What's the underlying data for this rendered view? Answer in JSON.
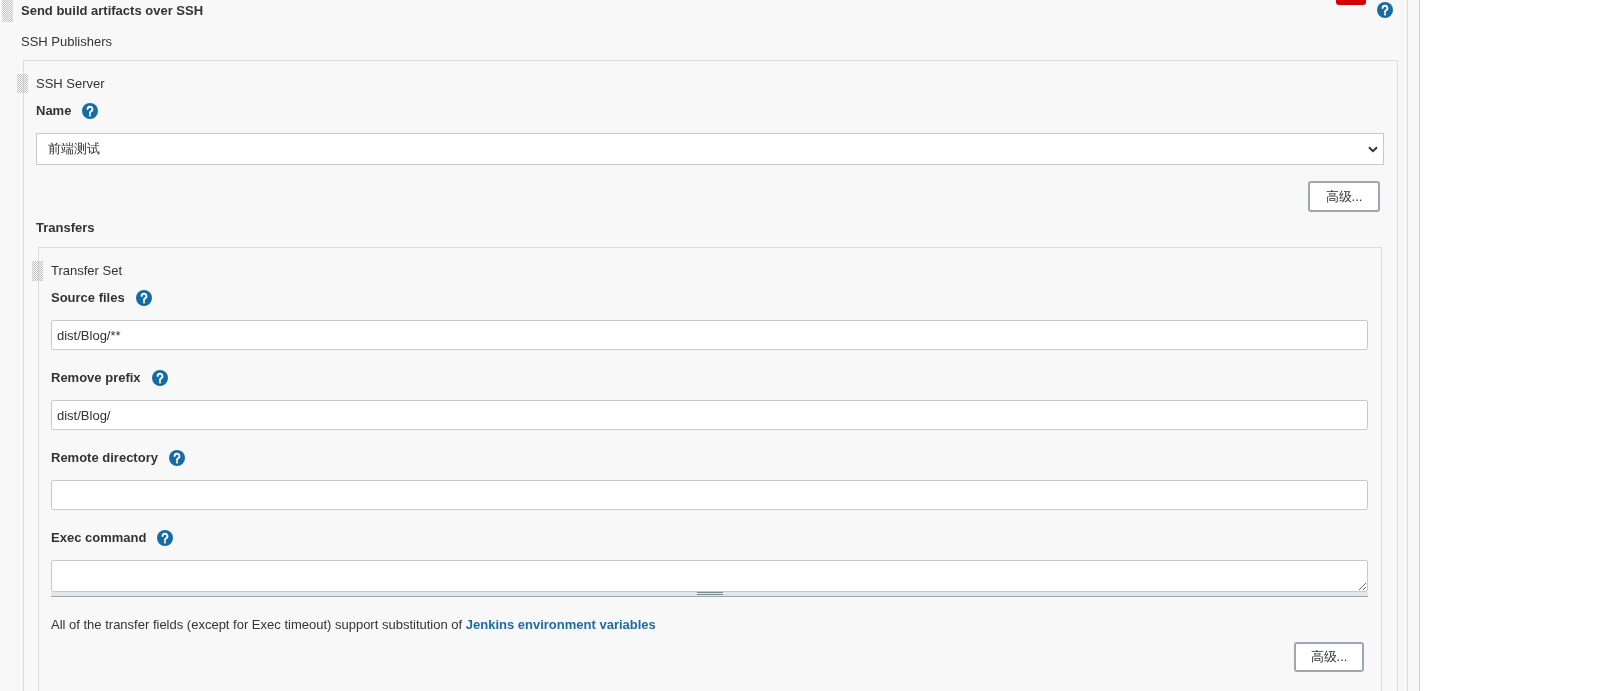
{
  "section": {
    "title": "Send build artifacts over SSH",
    "subtitle": "SSH Publishers"
  },
  "ssh_server": {
    "heading": "SSH Server",
    "fields": [
      {
        "kind": "select",
        "label": "Name",
        "value": "前端测试"
      }
    ],
    "advanced_button": "高级..."
  },
  "transfers": {
    "heading": "Transfers",
    "transfer_set": {
      "heading": "Transfer Set",
      "fields": [
        {
          "kind": "text",
          "label": "Source files",
          "value": "dist/Blog/**"
        },
        {
          "kind": "text",
          "label": "Remove prefix",
          "value": "dist/Blog/"
        },
        {
          "kind": "text",
          "label": "Remote directory"
        },
        {
          "kind": "textarea",
          "label": "Exec command"
        }
      ],
      "note": {
        "text": "All of the transfer fields (except for Exec timeout) support substitution of",
        "link": "Jenkins environment variables"
      },
      "advanced_button": "高级..."
    }
  }
}
